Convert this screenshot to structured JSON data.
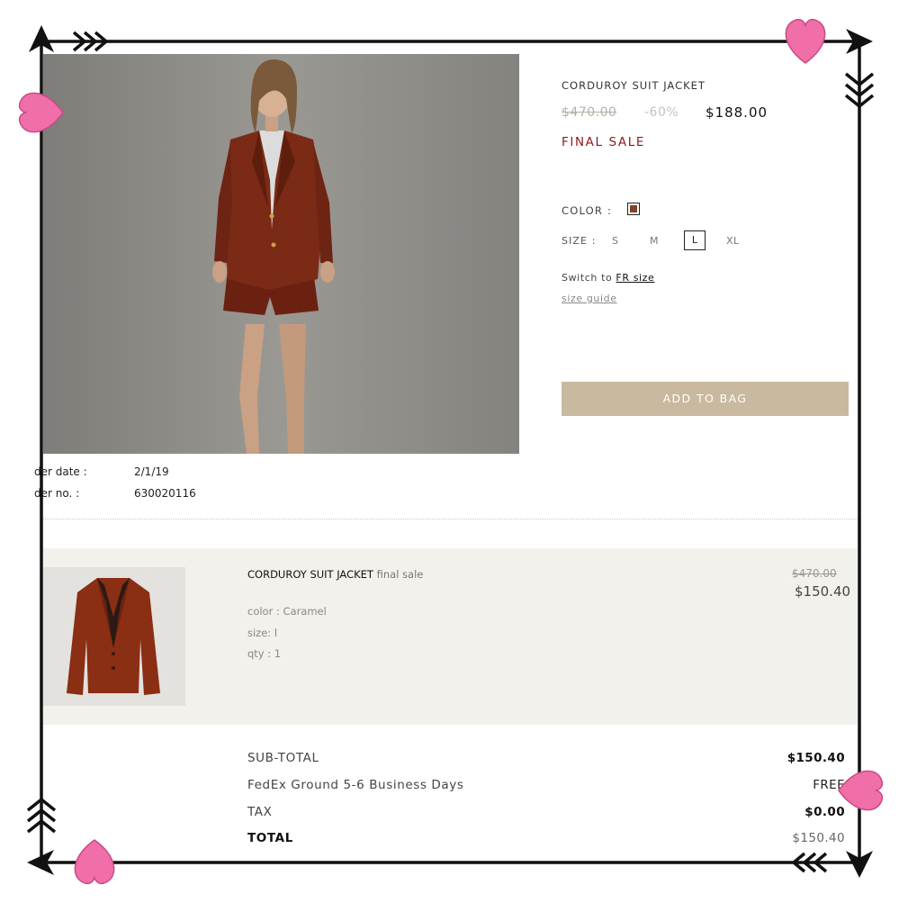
{
  "product": {
    "name": "CORDUROY SUIT JACKET",
    "old_price": "$470.00",
    "discount": "-60%",
    "new_price": "$188.00",
    "final_sale": "FINAL SALE",
    "color_label": "COLOR :",
    "color_swatch_hex": "#7a4526",
    "size_label": "SIZE :",
    "sizes": [
      "S",
      "M",
      "L",
      "XL"
    ],
    "selected_size": "L",
    "switch_prefix": "Switch to",
    "switch_link": "FR size",
    "size_guide": "size guide",
    "add_to_bag": "ADD TO BAG"
  },
  "order": {
    "date_label": "der date :",
    "date_value": "2/1/19",
    "number_label": "der no. :",
    "number_value": "630020116"
  },
  "line_item": {
    "title": "CORDUROY SUIT JACKET",
    "tag": "final sale",
    "color": "color : Caramel",
    "size": "size: l",
    "qty": "qty : 1",
    "old_price": "$470.00",
    "price": "$150.40"
  },
  "totals": {
    "subtotal_label": "SUB-TOTAL",
    "subtotal_value": "$150.40",
    "shipping_label": "FedEx Ground 5-6 Business Days",
    "shipping_value": "FREE",
    "tax_label": "TAX",
    "tax_value": "$0.00",
    "total_label": "TOTAL",
    "total_value": "$150.40"
  },
  "colors": {
    "accent_button": "#c8b99f",
    "final_sale_red": "#8b1a1a",
    "heart_pink": "#f06fa8",
    "frame": "#111111"
  },
  "decorations": {
    "icons": [
      "heart-icon",
      "heart-icon",
      "heart-icon",
      "heart-icon",
      "arrow-icon",
      "arrow-icon",
      "arrow-icon",
      "arrow-icon"
    ]
  }
}
